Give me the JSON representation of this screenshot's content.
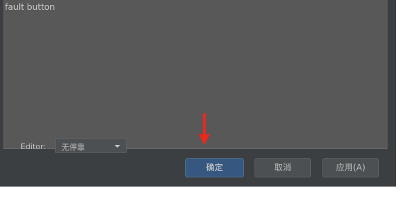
{
  "content": {
    "text": "fault button"
  },
  "editor": {
    "label": "Editor:",
    "selected": "无停靠"
  },
  "buttons": {
    "ok_label": "确定",
    "cancel_label": "取消",
    "apply_label": "应用(A)"
  },
  "annotation": {
    "arrow_color": "#e8291c"
  },
  "colors": {
    "dialog_bg": "#3c3f41",
    "content_bg": "#585858",
    "primary_button": "#365880"
  }
}
